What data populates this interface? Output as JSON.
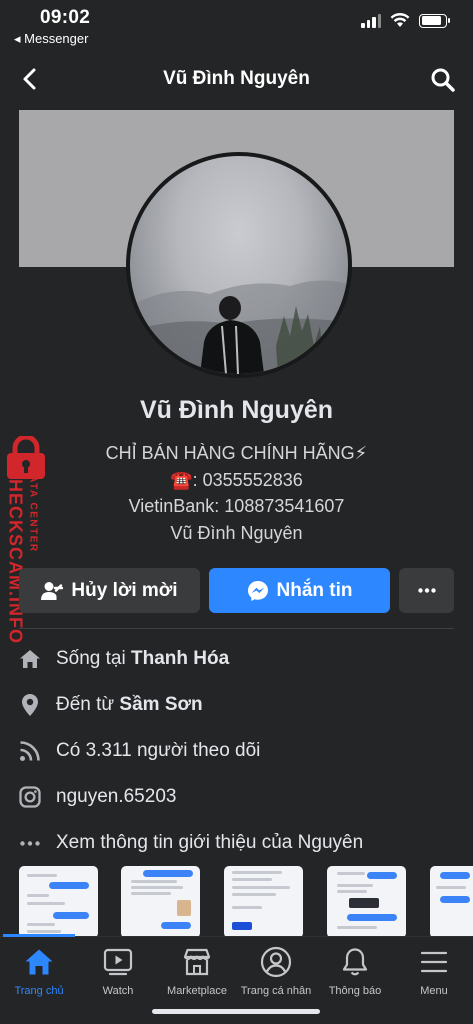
{
  "status_bar": {
    "time": "09:02",
    "back_label": "◂ Messenger",
    "battery_level": 0.85
  },
  "header": {
    "title": "Vũ Đình Nguyên"
  },
  "profile": {
    "name": "Vũ Đình Nguyên",
    "bio": [
      "CHỈ BÁN HÀNG CHÍNH HÃNG⚡",
      "☎️: 0355552836",
      "VietinBank: 108873541607",
      "Vũ Đình Nguyên"
    ]
  },
  "actions": {
    "cancel_request": "Hủy lời mời",
    "message": "Nhắn tin"
  },
  "details": [
    {
      "icon": "house-icon",
      "prefix": "Sống tại ",
      "value": "Thanh Hóa"
    },
    {
      "icon": "location-pin-icon",
      "prefix": "Đến từ ",
      "value": "Sầm Sơn"
    },
    {
      "icon": "rss-icon",
      "prefix": "Có 3.311 người theo dõi",
      "value": ""
    },
    {
      "icon": "instagram-icon",
      "prefix": "nguyen.65203",
      "value": ""
    },
    {
      "icon": "ellipsis-icon",
      "prefix": "Xem thông tin giới thiệu của Nguyên",
      "value": ""
    }
  ],
  "watermark": {
    "brand": "CHECKSCAM.INFO",
    "sub": "DATA CENTER"
  },
  "tabs": [
    {
      "label": "Trang chủ",
      "icon": "home-icon",
      "active": true
    },
    {
      "label": "Watch",
      "icon": "watch-video-icon",
      "active": false
    },
    {
      "label": "Marketplace",
      "icon": "marketplace-store-icon",
      "active": false
    },
    {
      "label": "Trang cá nhân",
      "icon": "profile-icon",
      "active": false
    },
    {
      "label": "Thông báo",
      "icon": "bell-icon",
      "active": false
    },
    {
      "label": "Menu",
      "icon": "hamburger-menu-icon",
      "active": false
    }
  ],
  "colors": {
    "accent": "#2d88ff",
    "background": "#242526",
    "button_secondary": "#3a3b3c",
    "watermark": "#d1262c"
  }
}
